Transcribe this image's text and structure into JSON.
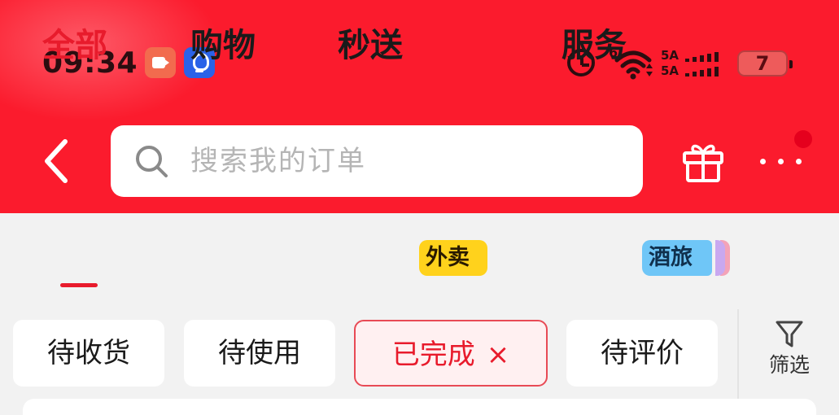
{
  "status_bar": {
    "time": "09:34",
    "network": "6",
    "sim1": "5A",
    "sim2": "5A",
    "battery": "7"
  },
  "colors": {
    "header_bg": "#fb1b2d",
    "accent_red": "#e81b2c",
    "waimai_badge": "#ffd21c",
    "jiulv_badge": "#6fc6f7"
  },
  "search": {
    "placeholder": "搜索我的订单"
  },
  "icons": {
    "back": "chevron-left-icon",
    "search": "search-icon",
    "gift": "gift-icon",
    "more": "more-icon",
    "filter": "filter-icon"
  },
  "tabs": [
    {
      "label": "全部",
      "active": true
    },
    {
      "label": "购物",
      "active": false
    },
    {
      "label": "秒送",
      "badge": "外卖",
      "active": false
    },
    {
      "label": "服务",
      "badge": "酒旅",
      "active": false
    }
  ],
  "filters": {
    "chips": [
      {
        "label": "待收货",
        "selected": false
      },
      {
        "label": "待使用",
        "selected": false
      },
      {
        "label": "已完成",
        "selected": true,
        "close": "×"
      },
      {
        "label": "待评价",
        "selected": false
      }
    ],
    "filter_label": "筛选"
  }
}
